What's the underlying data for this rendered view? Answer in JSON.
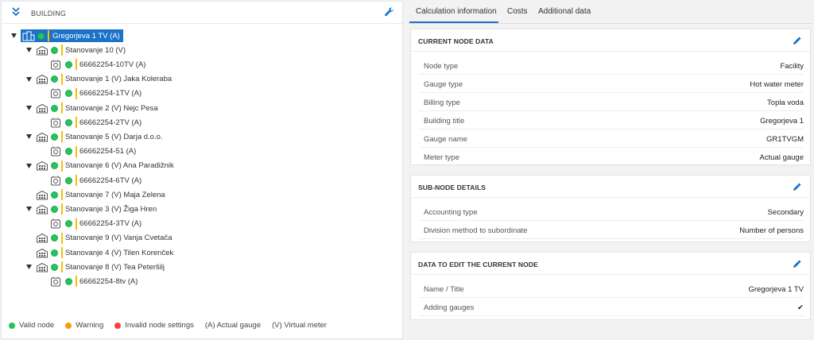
{
  "building": {
    "title": "BUILDING"
  },
  "tree": [
    {
      "label": "Gregorjeva 1 TV (A)",
      "kind": "facility",
      "level": 0,
      "caret": true,
      "selected": true
    },
    {
      "label": "Stanovanje 10 (V)",
      "kind": "apartment",
      "level": 1,
      "caret": true
    },
    {
      "label": "66662254-10TV (A)",
      "kind": "gauge",
      "level": 2,
      "caret": false
    },
    {
      "label": "Stanovanje 1 (V) Jaka Koleraba",
      "kind": "apartment",
      "level": 1,
      "caret": true
    },
    {
      "label": "66662254-1TV (A)",
      "kind": "gauge",
      "level": 2,
      "caret": false
    },
    {
      "label": "Stanovanje 2 (V) Nejc Pesa",
      "kind": "apartment",
      "level": 1,
      "caret": true
    },
    {
      "label": "66662254-2TV (A)",
      "kind": "gauge",
      "level": 2,
      "caret": false
    },
    {
      "label": "Stanovanje 5 (V) Darja d.o.o.",
      "kind": "apartment",
      "level": 1,
      "caret": true
    },
    {
      "label": "66662254-51 (A)",
      "kind": "gauge",
      "level": 2,
      "caret": false
    },
    {
      "label": "Stanovanje 6 (V) Ana Paradižnik",
      "kind": "apartment",
      "level": 1,
      "caret": true
    },
    {
      "label": "66662254-6TV (A)",
      "kind": "gauge",
      "level": 2,
      "caret": false
    },
    {
      "label": "Stanovanje 7 (V) Maja Zelena",
      "kind": "apartment",
      "level": 1,
      "caret": false
    },
    {
      "label": "Stanovanje 3 (V) Žiga Hren",
      "kind": "apartment",
      "level": 1,
      "caret": true
    },
    {
      "label": "66662254-3TV (A)",
      "kind": "gauge",
      "level": 2,
      "caret": false
    },
    {
      "label": "Stanovanje 9 (V) Vanja Cvetača",
      "kind": "apartment",
      "level": 1,
      "caret": false
    },
    {
      "label": "Stanovanje 4 (V) Tilen Korenček",
      "kind": "apartment",
      "level": 1,
      "caret": false
    },
    {
      "label": "Stanovanje 8 (V) Tea Peteršilj",
      "kind": "apartment",
      "level": 1,
      "caret": true
    },
    {
      "label": "66662254-8tv (A)",
      "kind": "gauge",
      "level": 2,
      "caret": false
    }
  ],
  "legend": {
    "valid": "Valid node",
    "warning": "Warning",
    "invalid": "Invalid node settings",
    "actual": "(A) Actual gauge",
    "virtual": "(V) Virtual meter",
    "colors": {
      "valid": "#22c55e",
      "warning": "#f59e0b",
      "invalid": "#ef4444",
      "status_bar": "#f2c200",
      "accent": "#1a73c9"
    }
  },
  "tabs": [
    "Calculation information",
    "Costs",
    "Additional data"
  ],
  "cards": {
    "current": {
      "title": "CURRENT NODE DATA",
      "rows": [
        {
          "k": "Node type",
          "v": "Facility"
        },
        {
          "k": "Gauge type",
          "v": "Hot water meter"
        },
        {
          "k": "Billing type",
          "v": "Topla voda"
        },
        {
          "k": "Building title",
          "v": "Gregorjeva 1"
        },
        {
          "k": "Gauge name",
          "v": "GR1TVGM"
        },
        {
          "k": "Meter type",
          "v": "Actual gauge"
        }
      ]
    },
    "subnode": {
      "title": "SUB-NODE DETAILS",
      "rows": [
        {
          "k": "Accounting type",
          "v": "Secondary"
        },
        {
          "k": "Division method to subordinate",
          "v": "Number of persons"
        }
      ]
    },
    "edit": {
      "title": "DATA TO EDIT THE CURRENT NODE",
      "rows": [
        {
          "k": "Name / Title",
          "v": "Gregorjeva 1 TV"
        },
        {
          "k": "Adding gauges",
          "v": "✔"
        }
      ]
    }
  }
}
